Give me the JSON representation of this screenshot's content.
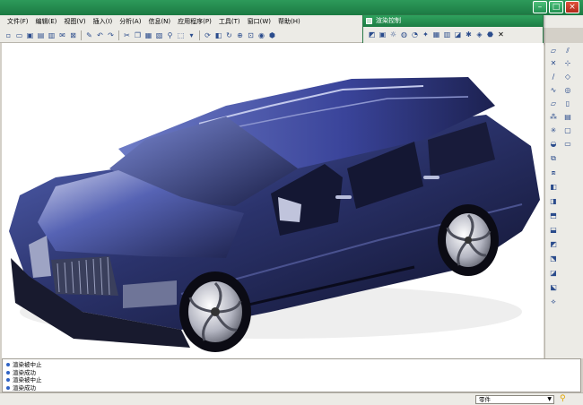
{
  "window": {
    "title": "",
    "controls": [
      "minimize",
      "maximize",
      "close"
    ]
  },
  "menubar": {
    "items": [
      {
        "label": "文件(F)"
      },
      {
        "label": "编辑(E)"
      },
      {
        "label": "视图(V)"
      },
      {
        "label": "插入(I)"
      },
      {
        "label": "分析(A)"
      },
      {
        "label": "信息(N)"
      },
      {
        "label": "应用程序(P)"
      },
      {
        "label": "工具(T)"
      },
      {
        "label": "窗口(W)"
      },
      {
        "label": "帮助(H)"
      }
    ]
  },
  "toolbar": {
    "icons": [
      "new-icon",
      "open-icon",
      "save-icon",
      "print-icon",
      "print-preview-icon",
      "send-icon",
      "close-window-icon",
      "repaint-icon",
      "undo-icon",
      "redo-icon",
      "cut-icon",
      "copy-icon",
      "paste-icon",
      "paste-special-icon",
      "find-icon",
      "select-icon",
      "more-icon",
      "regenerate-icon",
      "view-icon",
      "spin-icon",
      "zoom-icon",
      "refit-icon",
      "shade-icon",
      "model-tree-icon"
    ]
  },
  "render_panel": {
    "title": "渲染控制",
    "icons": [
      "scene-icon",
      "room-icon",
      "light-icon",
      "appearance-icon",
      "decal-icon",
      "effects-icon",
      "render-settings-icon",
      "render-window-icon",
      "region-render-icon",
      "palette-icon",
      "texture-icon",
      "save-render-icon",
      "close-icon"
    ]
  },
  "viewport": {
    "content": "3D rendered SUV model",
    "accent": "#3a4ba0"
  },
  "messages": [
    {
      "text": "渲染被中止"
    },
    {
      "text": "渲染成功"
    },
    {
      "text": "渲染被中止"
    },
    {
      "text": "渲染成功"
    }
  ],
  "status": {
    "filter_value": "零件"
  },
  "colors": {
    "title_bar": "#1c7a43",
    "chrome": "#ecebe6",
    "accent_blue": "#2f62c4"
  }
}
